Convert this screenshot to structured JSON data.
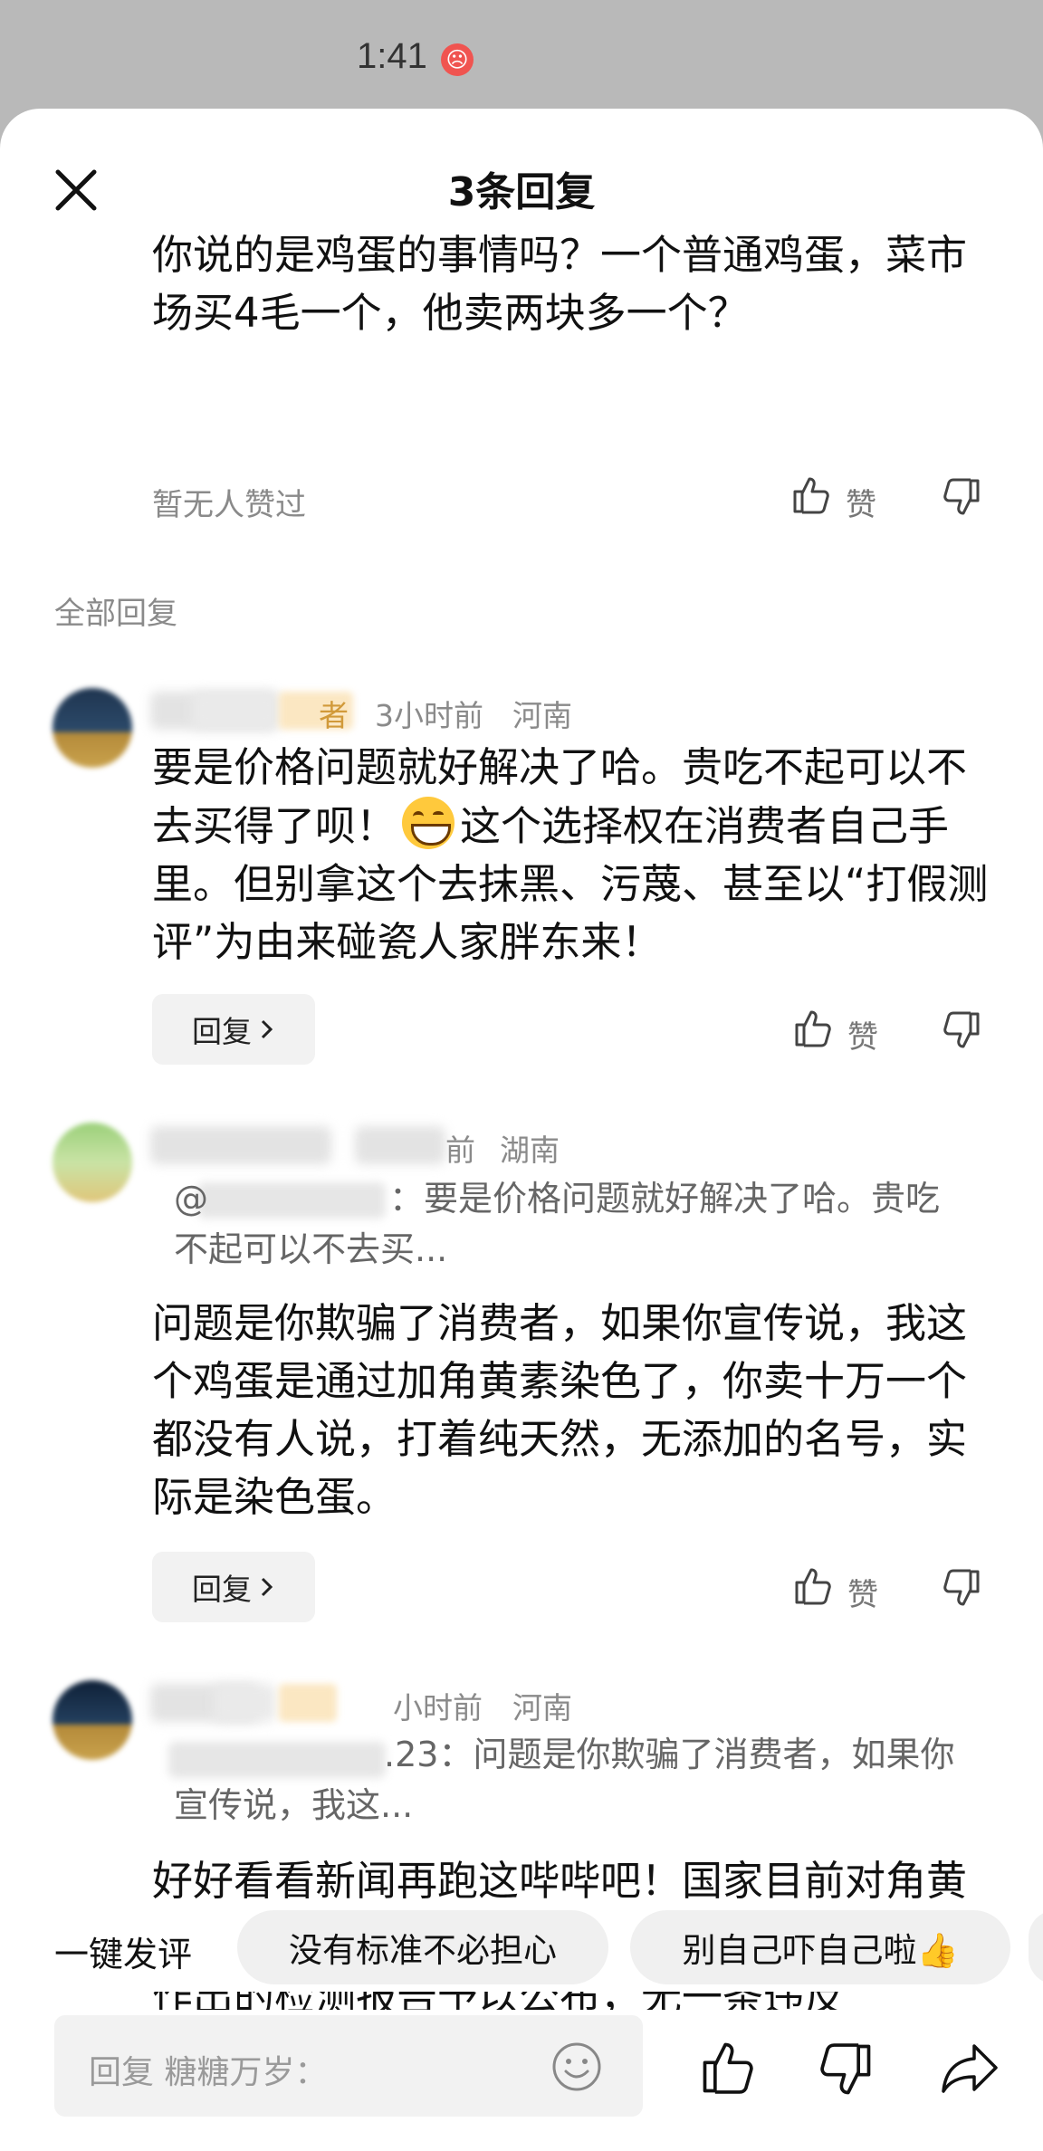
{
  "status": {
    "time": "1:41",
    "badge": "☹"
  },
  "sheet": {
    "title": "3条回复"
  },
  "main_comment": {
    "text": "你说的是鸡蛋的事情吗？一个普通鸡蛋，菜市场买4毛一个，他卖两块多一个？",
    "likes_text": "暂无人赞过",
    "like_label": "赞"
  },
  "section_label": "全部回复",
  "replies": [
    {
      "name_visible": "",
      "tag_visible": "者",
      "time": "3小时前",
      "location": "河南",
      "text_before": "要是价格问题就好解决了哈。贵吃不起可以不去买得了呗！",
      "text_after": "这个选择权在消费者自己手里。但别拿这个去抹黑、污蔑、甚至以“打假测评”为由来碰瓷人家胖东来！",
      "reply_label": "回复",
      "like_label": "赞"
    },
    {
      "time": "前",
      "location": "湖南",
      "quote_prefix": "@",
      "quote": "：要是价格问题就好解决了哈。贵吃不起可以不去买...",
      "text": "问题是你欺骗了消费者，如果你宣传说，我这个鸡蛋是通过加角黄素染色了，你卖十万一个都没有人说，打着纯天然，无添加的名号，实际是染色蛋。",
      "reply_label": "回复",
      "like_label": "赞"
    },
    {
      "time": "小时前",
      "location": "河南",
      "quote_prefix": ".23",
      "quote": "：问题是你欺骗了消费者，如果你宣传说，我这...",
      "text": "好好看看新闻再跑这哔哔吧！国家目前对角黄素并无标准。胖东来已经将委托三家检测机构作出的检测报告予以公布，无一条违反"
    }
  ],
  "quick_reply": {
    "label": "一键发评",
    "chips": [
      "没有标准不必担心",
      "别自己吓自己啦👍"
    ]
  },
  "input": {
    "placeholder": "回复 糖糖万岁："
  },
  "icons": [
    "close-icon",
    "thumbs-up-icon",
    "thumbs-down-icon",
    "chevron-right-icon",
    "emoji-icon",
    "share-icon"
  ]
}
